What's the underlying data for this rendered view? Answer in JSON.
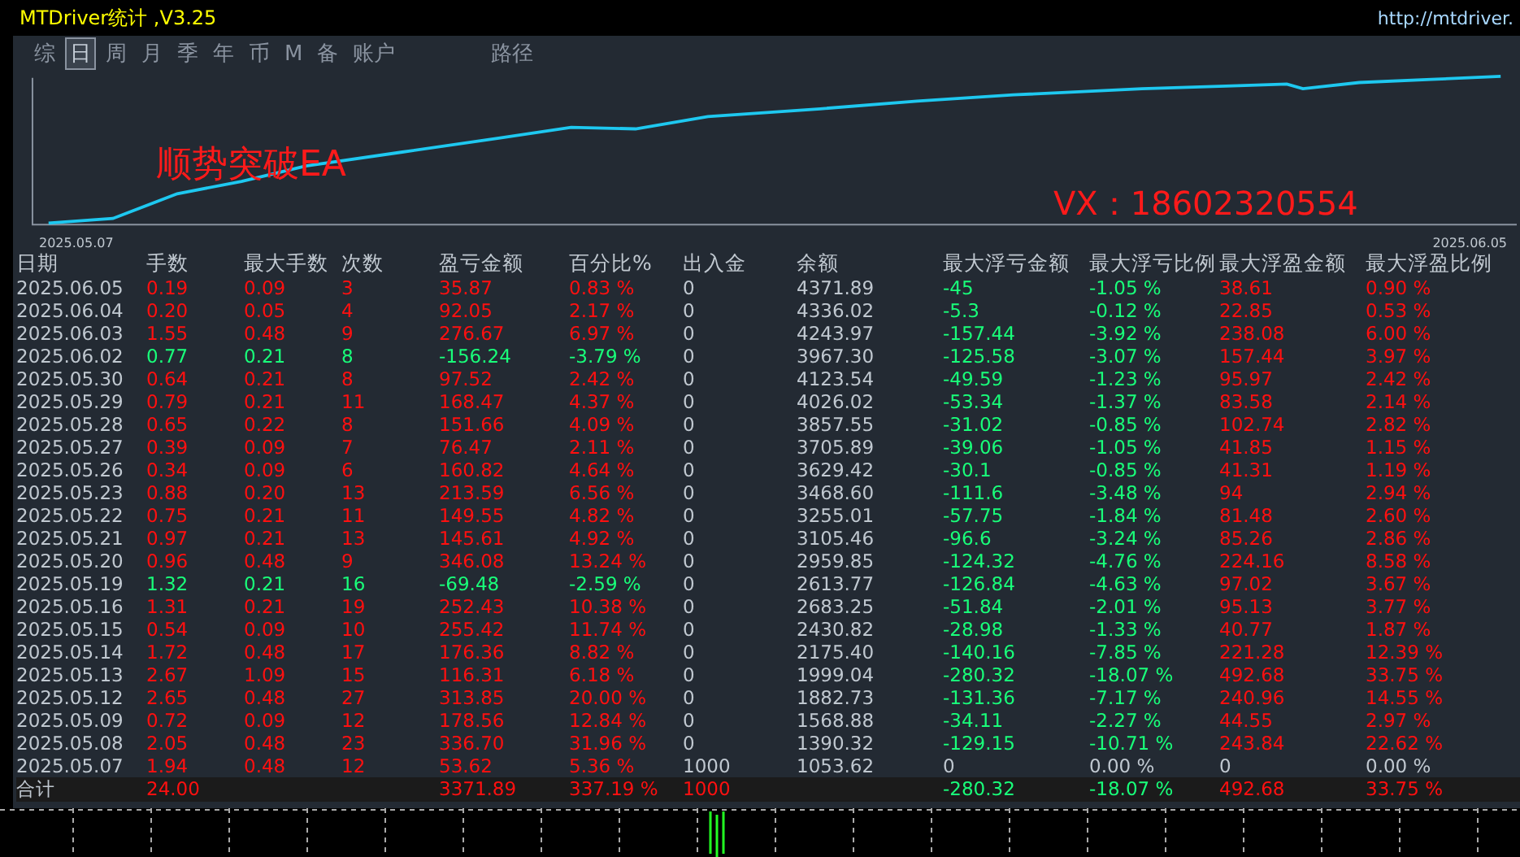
{
  "window": {
    "title": "MTDriver统计 ,V3.25",
    "url": "http://mtdriver."
  },
  "tabs": [
    {
      "label": "综",
      "selected": false
    },
    {
      "label": "日",
      "selected": true
    },
    {
      "label": "周",
      "selected": false
    },
    {
      "label": "月",
      "selected": false
    },
    {
      "label": "季",
      "selected": false
    },
    {
      "label": "年",
      "selected": false
    },
    {
      "label": "币",
      "selected": false
    },
    {
      "label": "M",
      "selected": false
    },
    {
      "label": "备",
      "selected": false
    },
    {
      "label": "账户",
      "selected": false
    }
  ],
  "path_tab": {
    "label": "路径",
    "selected": false
  },
  "equity_chart": {
    "start_label": "2025.05.07",
    "end_label": "2025.06.05",
    "overlay_title": "顺势突破EA",
    "overlay_contact": "VX：18602320554"
  },
  "table": {
    "columns": [
      "日期",
      "手数",
      "最大手数",
      "次数",
      "盈亏金额",
      "百分比%",
      "出入金",
      "余额",
      "最大浮亏金额",
      "最大浮亏比例",
      "最大浮盈金额",
      "最大浮盈比例"
    ],
    "rows": [
      {
        "cells": [
          "2025.06.05",
          "0.19",
          "0.09",
          "3",
          "35.87",
          "0.83 %",
          "0",
          "4371.89",
          "-45",
          "-1.05 %",
          "38.61",
          "0.90 %"
        ],
        "loss": false,
        "float_zero": false
      },
      {
        "cells": [
          "2025.06.04",
          "0.20",
          "0.05",
          "4",
          "92.05",
          "2.17 %",
          "0",
          "4336.02",
          "-5.3",
          "-0.12 %",
          "22.85",
          "0.53 %"
        ],
        "loss": false,
        "float_zero": false
      },
      {
        "cells": [
          "2025.06.03",
          "1.55",
          "0.48",
          "9",
          "276.67",
          "6.97 %",
          "0",
          "4243.97",
          "-157.44",
          "-3.92 %",
          "238.08",
          "6.00 %"
        ],
        "loss": false,
        "float_zero": false
      },
      {
        "cells": [
          "2025.06.02",
          "0.77",
          "0.21",
          "8",
          "-156.24",
          "-3.79 %",
          "0",
          "3967.30",
          "-125.58",
          "-3.07 %",
          "157.44",
          "3.97 %"
        ],
        "loss": true,
        "float_zero": false
      },
      {
        "cells": [
          "2025.05.30",
          "0.64",
          "0.21",
          "8",
          "97.52",
          "2.42 %",
          "0",
          "4123.54",
          "-49.59",
          "-1.23 %",
          "95.97",
          "2.42 %"
        ],
        "loss": false,
        "float_zero": false
      },
      {
        "cells": [
          "2025.05.29",
          "0.79",
          "0.21",
          "11",
          "168.47",
          "4.37 %",
          "0",
          "4026.02",
          "-53.34",
          "-1.37 %",
          "83.58",
          "2.14 %"
        ],
        "loss": false,
        "float_zero": false
      },
      {
        "cells": [
          "2025.05.28",
          "0.65",
          "0.22",
          "8",
          "151.66",
          "4.09 %",
          "0",
          "3857.55",
          "-31.02",
          "-0.85 %",
          "102.74",
          "2.82 %"
        ],
        "loss": false,
        "float_zero": false
      },
      {
        "cells": [
          "2025.05.27",
          "0.39",
          "0.09",
          "7",
          "76.47",
          "2.11 %",
          "0",
          "3705.89",
          "-39.06",
          "-1.05 %",
          "41.85",
          "1.15 %"
        ],
        "loss": false,
        "float_zero": false
      },
      {
        "cells": [
          "2025.05.26",
          "0.34",
          "0.09",
          "6",
          "160.82",
          "4.64 %",
          "0",
          "3629.42",
          "-30.1",
          "-0.85 %",
          "41.31",
          "1.19 %"
        ],
        "loss": false,
        "float_zero": false
      },
      {
        "cells": [
          "2025.05.23",
          "0.88",
          "0.20",
          "13",
          "213.59",
          "6.56 %",
          "0",
          "3468.60",
          "-111.6",
          "-3.48 %",
          "94",
          "2.94 %"
        ],
        "loss": false,
        "float_zero": false
      },
      {
        "cells": [
          "2025.05.22",
          "0.75",
          "0.21",
          "11",
          "149.55",
          "4.82 %",
          "0",
          "3255.01",
          "-57.75",
          "-1.84 %",
          "81.48",
          "2.60 %"
        ],
        "loss": false,
        "float_zero": false
      },
      {
        "cells": [
          "2025.05.21",
          "0.97",
          "0.21",
          "13",
          "145.61",
          "4.92 %",
          "0",
          "3105.46",
          "-96.6",
          "-3.24 %",
          "85.26",
          "2.86 %"
        ],
        "loss": false,
        "float_zero": false
      },
      {
        "cells": [
          "2025.05.20",
          "0.96",
          "0.48",
          "9",
          "346.08",
          "13.24 %",
          "0",
          "2959.85",
          "-124.32",
          "-4.76 %",
          "224.16",
          "8.58 %"
        ],
        "loss": false,
        "float_zero": false
      },
      {
        "cells": [
          "2025.05.19",
          "1.32",
          "0.21",
          "16",
          "-69.48",
          "-2.59 %",
          "0",
          "2613.77",
          "-126.84",
          "-4.63 %",
          "97.02",
          "3.67 %"
        ],
        "loss": true,
        "float_zero": false
      },
      {
        "cells": [
          "2025.05.16",
          "1.31",
          "0.21",
          "19",
          "252.43",
          "10.38 %",
          "0",
          "2683.25",
          "-51.84",
          "-2.01 %",
          "95.13",
          "3.77 %"
        ],
        "loss": false,
        "float_zero": false
      },
      {
        "cells": [
          "2025.05.15",
          "0.54",
          "0.09",
          "10",
          "255.42",
          "11.74 %",
          "0",
          "2430.82",
          "-28.98",
          "-1.33 %",
          "40.77",
          "1.87 %"
        ],
        "loss": false,
        "float_zero": false
      },
      {
        "cells": [
          "2025.05.14",
          "1.72",
          "0.48",
          "17",
          "176.36",
          "8.82 %",
          "0",
          "2175.40",
          "-140.16",
          "-7.85 %",
          "221.28",
          "12.39 %"
        ],
        "loss": false,
        "float_zero": false
      },
      {
        "cells": [
          "2025.05.13",
          "2.67",
          "1.09",
          "15",
          "116.31",
          "6.18 %",
          "0",
          "1999.04",
          "-280.32",
          "-18.07 %",
          "492.68",
          "33.75 %"
        ],
        "loss": false,
        "float_zero": false
      },
      {
        "cells": [
          "2025.05.12",
          "2.65",
          "0.48",
          "27",
          "313.85",
          "20.00 %",
          "0",
          "1882.73",
          "-131.36",
          "-7.17 %",
          "240.96",
          "14.55 %"
        ],
        "loss": false,
        "float_zero": false
      },
      {
        "cells": [
          "2025.05.09",
          "0.72",
          "0.09",
          "12",
          "178.56",
          "12.84 %",
          "0",
          "1568.88",
          "-34.11",
          "-2.27 %",
          "44.55",
          "2.97 %"
        ],
        "loss": false,
        "float_zero": false
      },
      {
        "cells": [
          "2025.05.08",
          "2.05",
          "0.48",
          "23",
          "336.70",
          "31.96 %",
          "0",
          "1390.32",
          "-129.15",
          "-10.71 %",
          "243.84",
          "22.62 %"
        ],
        "loss": false,
        "float_zero": false
      },
      {
        "cells": [
          "2025.05.07",
          "1.94",
          "0.48",
          "12",
          "53.62",
          "5.36 %",
          "1000",
          "1053.62",
          "0",
          "0.00 %",
          "0",
          "0.00 %"
        ],
        "loss": false,
        "float_zero": true
      }
    ],
    "total": {
      "label": "合计",
      "lots": "24.00",
      "pnl": "3371.89",
      "pct": "337.19 %",
      "cash": "1000",
      "max_dd": "-280.32",
      "max_dd_pct": "-18.07 %",
      "max_fp": "492.68",
      "max_fp_pct": "33.75 %"
    }
  }
}
